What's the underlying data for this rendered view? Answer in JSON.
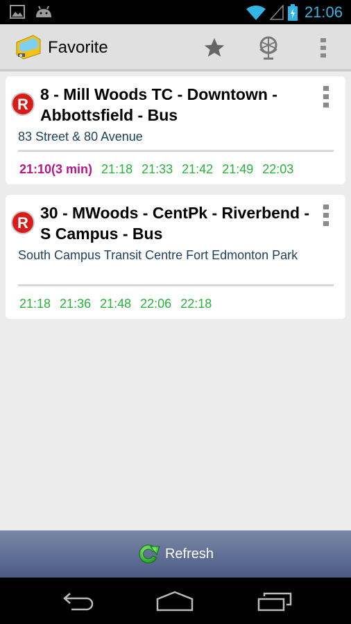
{
  "status_bar": {
    "time": "21:06",
    "icons": [
      "picture-icon",
      "android-icon",
      "wifi-icon",
      "signal-icon",
      "battery-charging-icon"
    ],
    "accent": "#33b5e5"
  },
  "action_bar": {
    "title": "Favorite",
    "actions": [
      "star-icon",
      "globe-icon",
      "overflow-menu-icon"
    ]
  },
  "favorites": [
    {
      "route": "8 - Mill Woods TC - Downtown - Abbottsfield - Bus",
      "stop": "83 Street & 80 Avenue",
      "next_time": "21:10(3 min)",
      "times": [
        "21:18",
        "21:33",
        "21:42",
        "21:49",
        "22:03"
      ]
    },
    {
      "route": "30 - MWoods - CentPk - Riverbend - S Campus - Bus",
      "stop": "South Campus Transit Centre Fort Edmonton Park",
      "next_time": null,
      "times": [
        "21:18",
        "21:36",
        "21:48",
        "22:06",
        "22:18"
      ]
    }
  ],
  "refresh": {
    "label": "Refresh"
  },
  "colors": {
    "next_time": "#b5158b",
    "time": "#27b33a",
    "stop": "#1d3f5e"
  }
}
